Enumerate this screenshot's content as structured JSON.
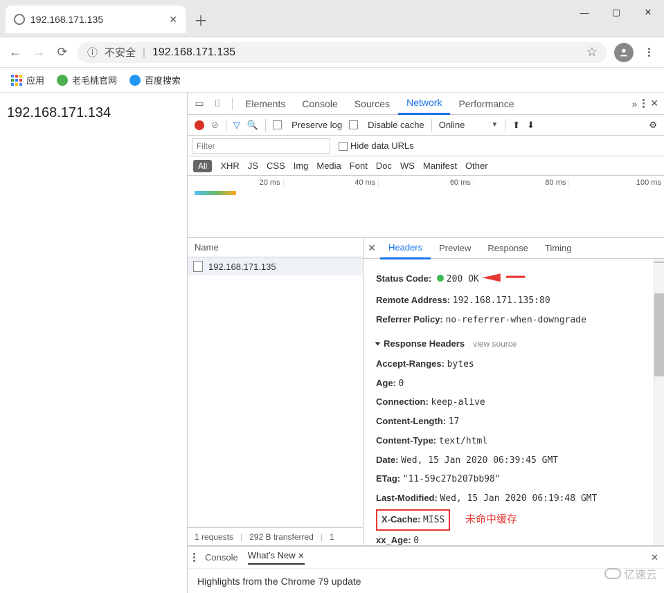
{
  "browser": {
    "tab_title": "192.168.171.135",
    "url": "192.168.171.135",
    "insecure_label": "不安全"
  },
  "bookmarks": {
    "apps": "应用",
    "items": [
      "老毛桃官网",
      "百度搜索"
    ]
  },
  "page": {
    "body_text": "192.168.171.134"
  },
  "devtools": {
    "tabs": [
      "Elements",
      "Console",
      "Sources",
      "Network",
      "Performance"
    ],
    "active_tab": "Network",
    "toolbar": {
      "preserve_log": "Preserve log",
      "disable_cache": "Disable cache",
      "throttling": "Online"
    },
    "filter": {
      "placeholder": "Filter",
      "hide_data_urls": "Hide data URLs"
    },
    "types": [
      "All",
      "XHR",
      "JS",
      "CSS",
      "Img",
      "Media",
      "Font",
      "Doc",
      "WS",
      "Manifest",
      "Other"
    ],
    "timeline_ticks": [
      "20 ms",
      "40 ms",
      "60 ms",
      "80 ms",
      "100 ms"
    ],
    "list": {
      "header": "Name",
      "items": [
        "192.168.171.135"
      ]
    },
    "detail_tabs": [
      "Headers",
      "Preview",
      "Response",
      "Timing"
    ],
    "detail_active": "Headers",
    "general": {
      "status_code_label": "Status Code:",
      "status_code_value": "200 OK",
      "remote_address_label": "Remote Address:",
      "remote_address_value": "192.168.171.135:80",
      "referrer_policy_label": "Referrer Policy:",
      "referrer_policy_value": "no-referrer-when-downgrade"
    },
    "response_headers_title": "Response Headers",
    "view_source": "view source",
    "response_headers": [
      {
        "k": "Accept-Ranges:",
        "v": "bytes"
      },
      {
        "k": "Age:",
        "v": "0"
      },
      {
        "k": "Connection:",
        "v": "keep-alive"
      },
      {
        "k": "Content-Length:",
        "v": "17"
      },
      {
        "k": "Content-Type:",
        "v": "text/html"
      },
      {
        "k": "Date:",
        "v": "Wed, 15 Jan 2020 06:39:45 GMT"
      },
      {
        "k": "ETag:",
        "v": "\"11-59c27b207bb98\""
      },
      {
        "k": "Last-Modified:",
        "v": "Wed, 15 Jan 2020 06:19:48 GMT"
      },
      {
        "k": "X-Cache:",
        "v": "MISS"
      },
      {
        "k": "xx_Age:",
        "v": "0"
      }
    ],
    "annotation": "未命中缓存",
    "summary": {
      "requests": "1 requests",
      "transferred": "292 B transferred",
      "resources_prefix": "1"
    },
    "drawer": {
      "tabs": [
        "Console",
        "What's New"
      ],
      "active": "What's New",
      "body": "Highlights from the Chrome 79 update"
    }
  },
  "watermark": "亿速云"
}
